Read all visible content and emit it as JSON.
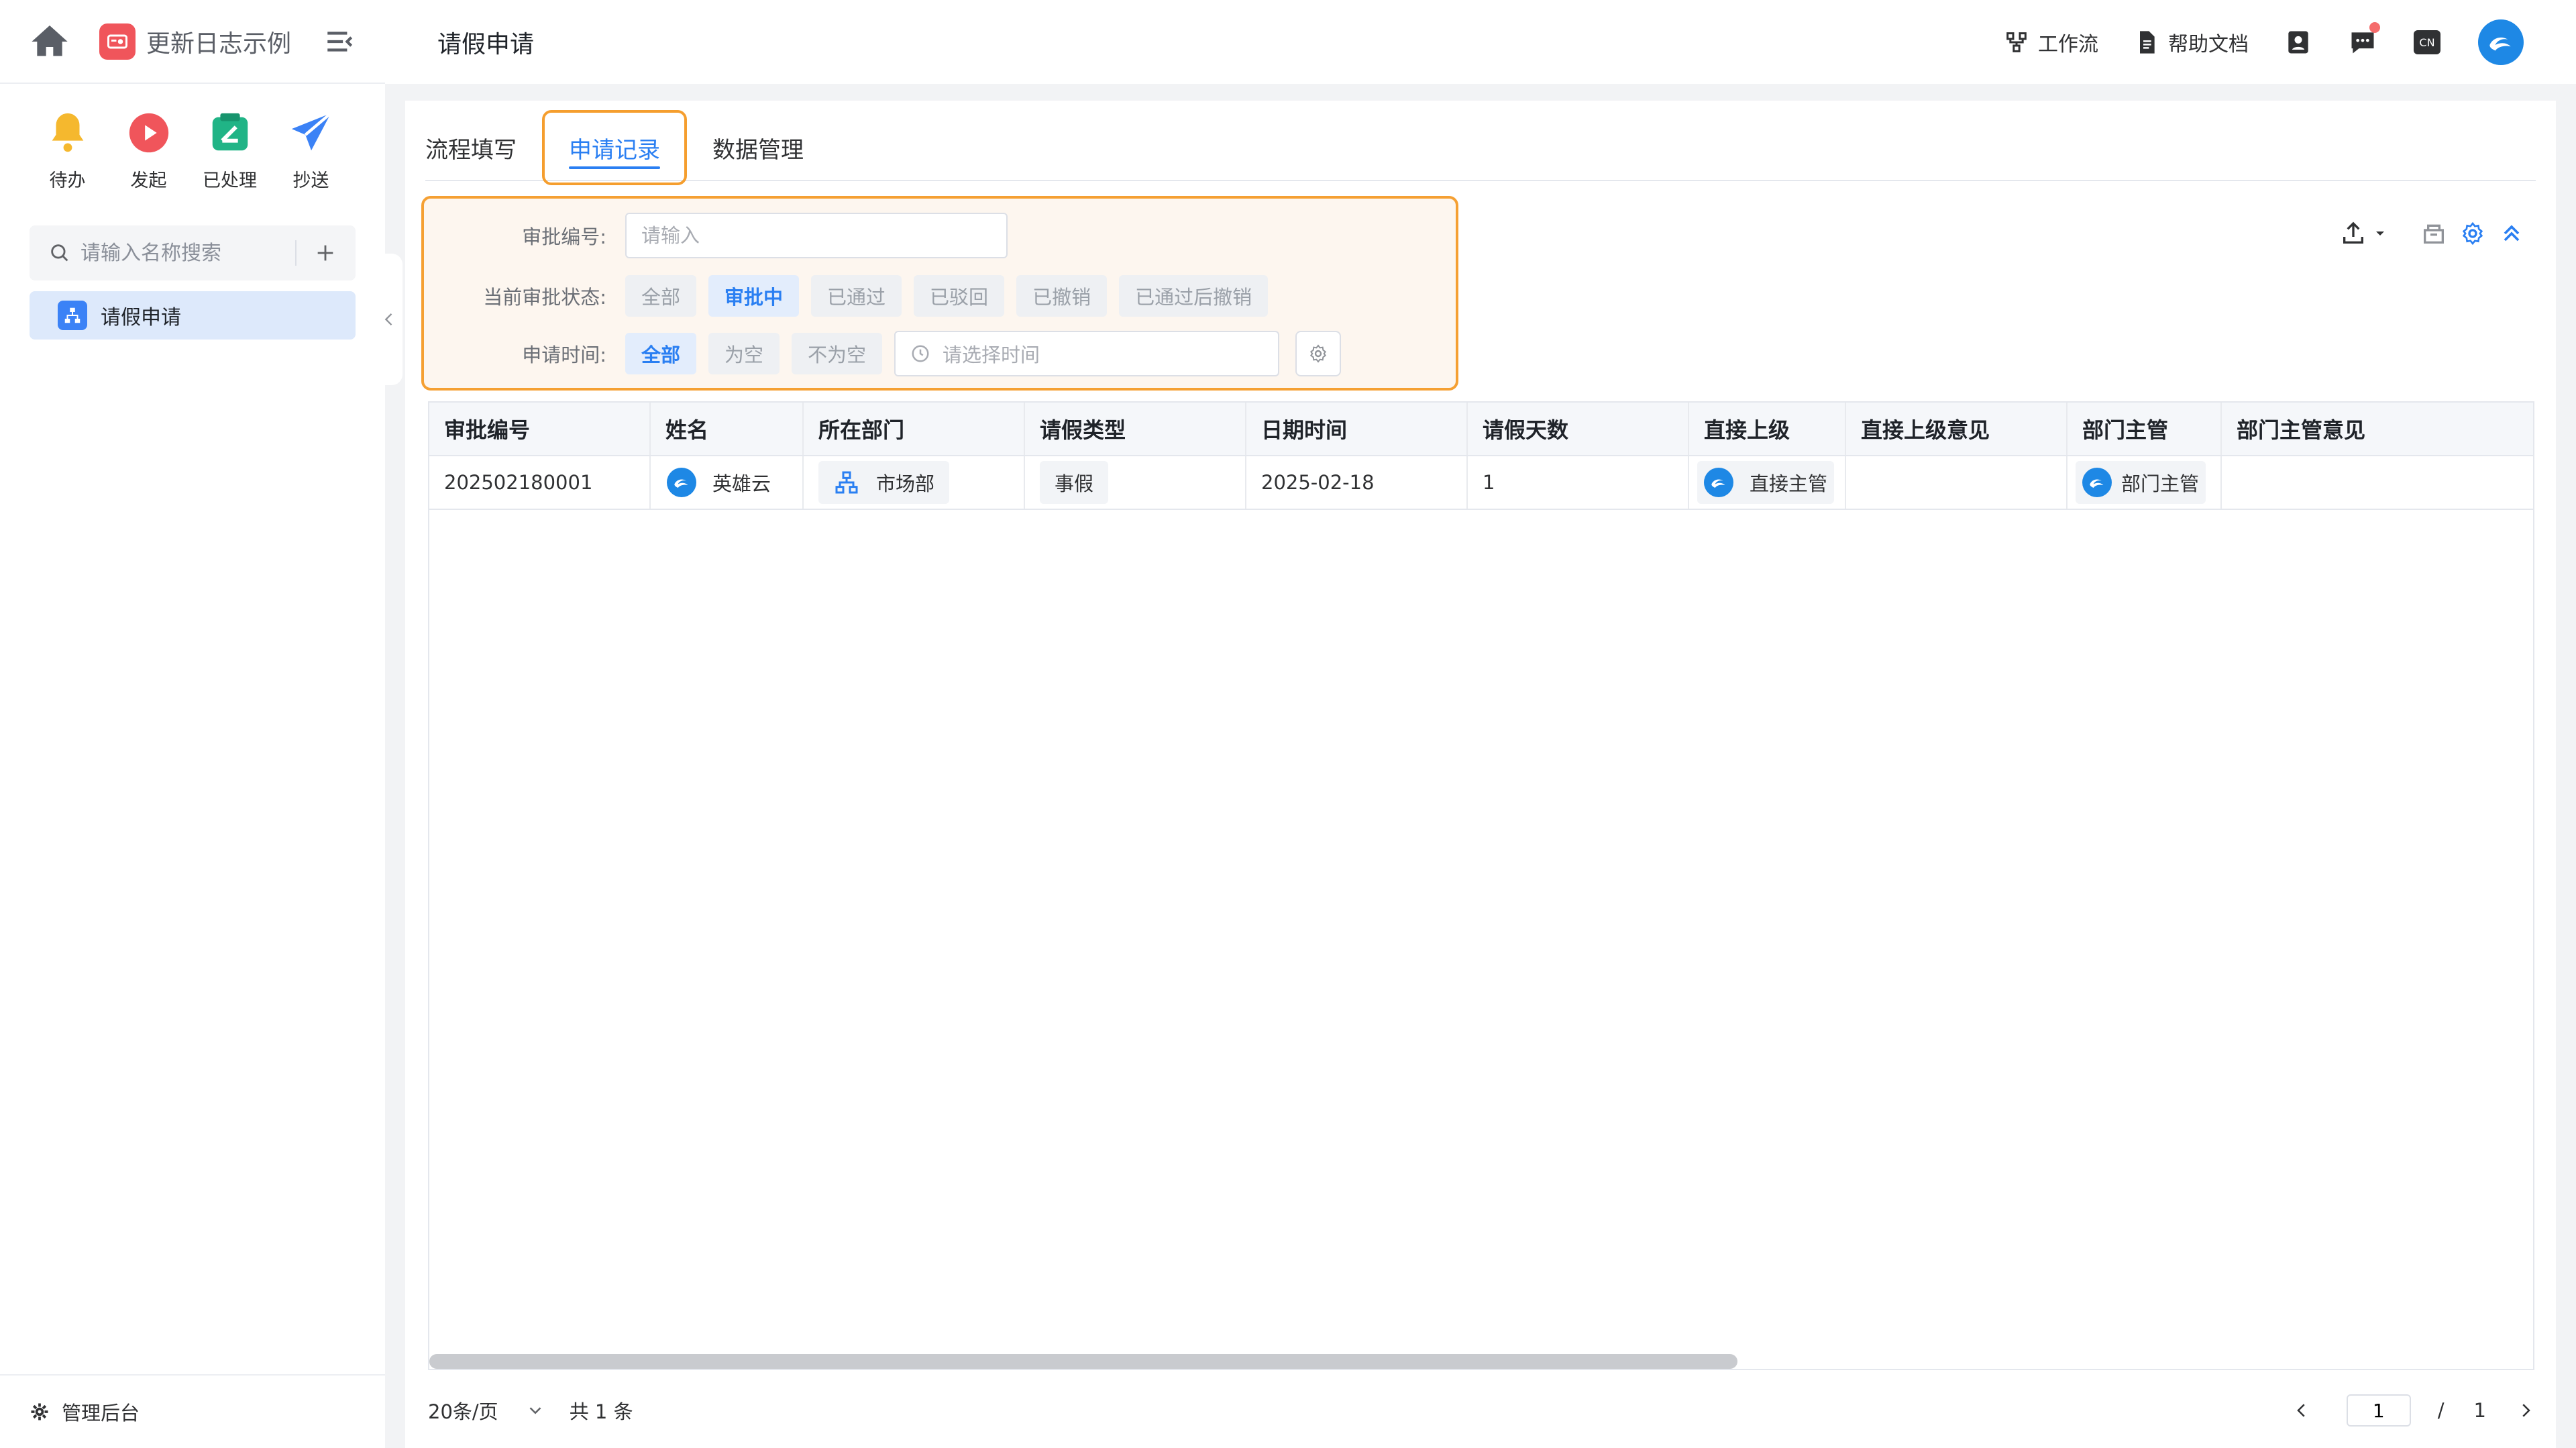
{
  "sidebar": {
    "app_name": "更新日志示例",
    "quick_actions": [
      {
        "label": "待办",
        "icon": "bell-icon"
      },
      {
        "label": "发起",
        "icon": "play-icon"
      },
      {
        "label": "已处理",
        "icon": "done-icon"
      },
      {
        "label": "抄送",
        "icon": "send-icon"
      }
    ],
    "search_placeholder": "请输入名称搜索",
    "items": [
      {
        "label": "请假申请",
        "icon": "org-icon",
        "active": true
      }
    ],
    "admin_label": "管理后台"
  },
  "header": {
    "title": "请假申请",
    "workflow_label": "工作流",
    "help_label": "帮助文档",
    "lang_badge": "CN"
  },
  "tabs": [
    {
      "label": "流程填写",
      "active": false
    },
    {
      "label": "申请记录",
      "active": true
    },
    {
      "label": "数据管理",
      "active": false
    }
  ],
  "filter": {
    "approval_no_label": "审批编号:",
    "approval_no_placeholder": "请输入",
    "status_label": "当前审批状态:",
    "status_options": [
      "全部",
      "审批中",
      "已通过",
      "已驳回",
      "已撤销",
      "已通过后撤销"
    ],
    "status_selected": "审批中",
    "time_label": "申请时间:",
    "time_options": [
      "全部",
      "为空",
      "不为空"
    ],
    "time_selected": "全部",
    "time_placeholder": "请选择时间"
  },
  "table": {
    "columns": [
      "审批编号",
      "姓名",
      "所在部门",
      "请假类型",
      "日期时间",
      "请假天数",
      "直接上级",
      "直接上级意见",
      "部门主管",
      "部门主管意见"
    ],
    "rows": [
      {
        "approval_no": "202502180001",
        "name": "英雄云",
        "department": "市场部",
        "leave_type": "事假",
        "date": "2025-02-18",
        "days": "1",
        "direct_supervisor": "直接主管",
        "direct_supervisor_opinion": "",
        "dept_manager": "部门主管",
        "dept_manager_opinion": ""
      }
    ]
  },
  "pagination": {
    "page_size": "20条/页",
    "total": "共 1 条",
    "current_page": "1",
    "separator": "/",
    "total_pages": "1"
  },
  "colors": {
    "accent": "#2a7ff2",
    "highlight_border": "#f5a033",
    "highlight_bg": "#fdf6ef"
  }
}
